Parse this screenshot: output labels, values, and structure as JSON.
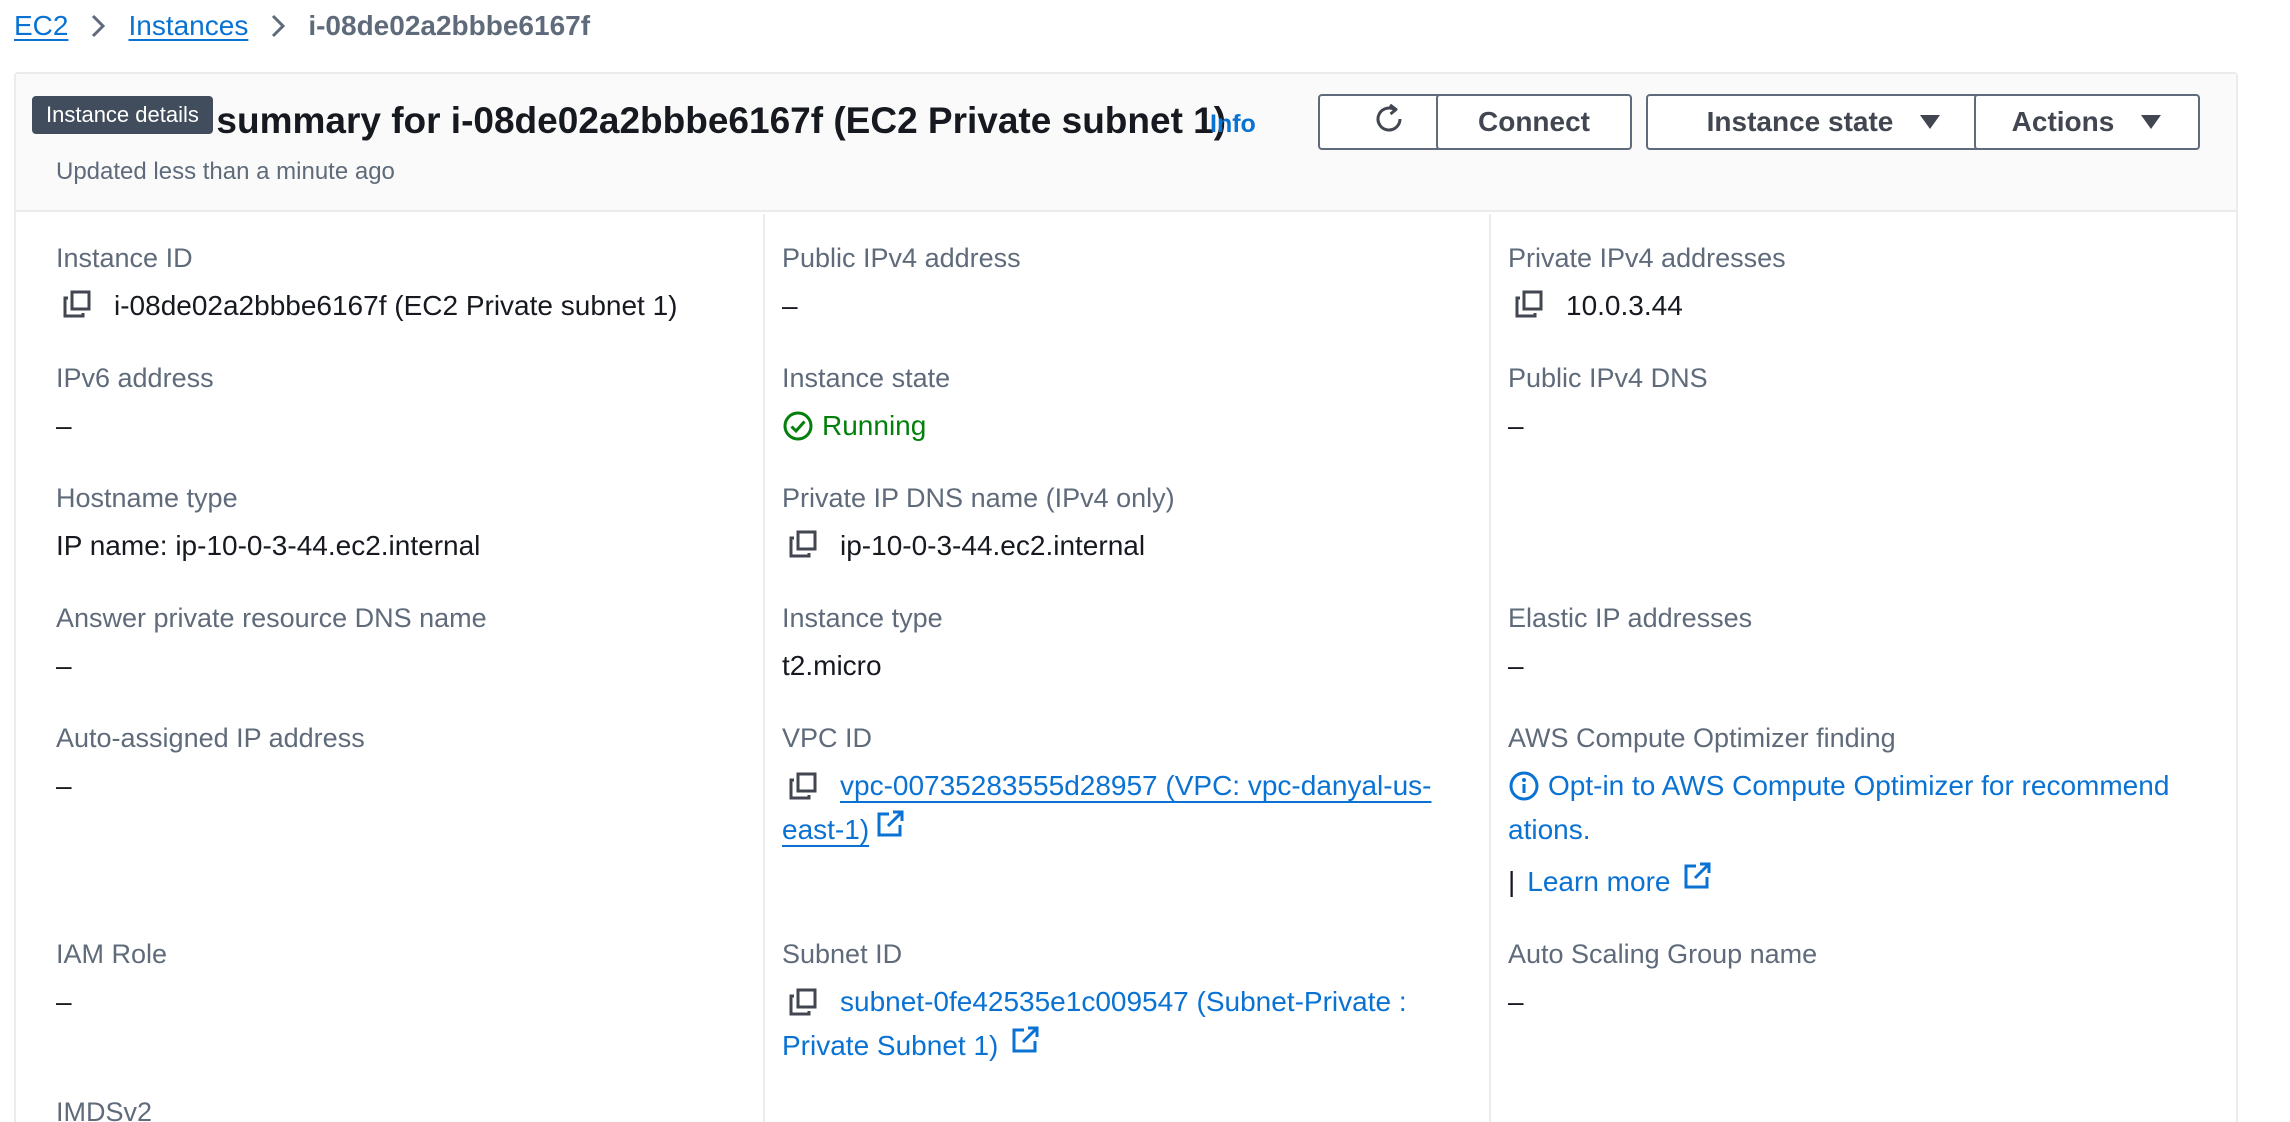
{
  "breadcrumb": {
    "items": [
      "EC2",
      "Instances"
    ],
    "current": "i-08de02a2bbbe6167f"
  },
  "header": {
    "title": "Instance summary for i-08de02a2bbbe6167f (EC2 Private subnet 1)",
    "info_label": "Info",
    "updated": "Updated less than a minute ago",
    "tooltip": "Instance details",
    "buttons": {
      "refresh_icon": "refresh-icon",
      "connect": "Connect",
      "instance_state": "Instance state",
      "actions": "Actions"
    }
  },
  "fields": {
    "instance_id": {
      "label": "Instance ID",
      "value": "i-08de02a2bbbe6167f (EC2 Private subnet 1)"
    },
    "public_ipv4": {
      "label": "Public IPv4 address",
      "value": "–"
    },
    "private_ipv4": {
      "label": "Private IPv4 addresses",
      "value": "10.0.3.44"
    },
    "ipv6": {
      "label": "IPv6 address",
      "value": "–"
    },
    "instance_state": {
      "label": "Instance state",
      "value": "Running"
    },
    "public_dns": {
      "label": "Public IPv4 DNS",
      "value": "–"
    },
    "hostname_type": {
      "label": "Hostname type",
      "value": "IP name: ip-10-0-3-44.ec2.internal"
    },
    "private_dns": {
      "label": "Private IP DNS name (IPv4 only)",
      "value": "ip-10-0-3-44.ec2.internal"
    },
    "answer_dns": {
      "label": "Answer private resource DNS name",
      "value": "–"
    },
    "instance_type": {
      "label": "Instance type",
      "value": "t2.micro"
    },
    "elastic_ip": {
      "label": "Elastic IP addresses",
      "value": "–"
    },
    "auto_ip": {
      "label": "Auto-assigned IP address",
      "value": "–"
    },
    "vpc_id": {
      "label": "VPC ID",
      "line1": "vpc-00735283555d28957 (VPC: vpc-danyal-us-",
      "line2": "east-1)"
    },
    "optimizer": {
      "label": "AWS Compute Optimizer finding",
      "line1": "Opt-in to AWS Compute Optimizer for recommend",
      "line2": "ations.",
      "separator": "|",
      "learn_more": "Learn more"
    },
    "iam_role": {
      "label": "IAM Role",
      "value": "–"
    },
    "subnet_id": {
      "label": "Subnet ID",
      "line1": "subnet-0fe42535e1c009547 (Subnet-Private :",
      "line2": "Private Subnet 1)"
    },
    "asg_name": {
      "label": "Auto Scaling Group name",
      "value": "–"
    },
    "imdsv2": {
      "label": "IMDSv2"
    }
  },
  "colors": {
    "link": "#0972d3",
    "success": "#037f0c",
    "label": "#5f6b7a",
    "text": "#16191f",
    "border": "#e9ebed"
  }
}
